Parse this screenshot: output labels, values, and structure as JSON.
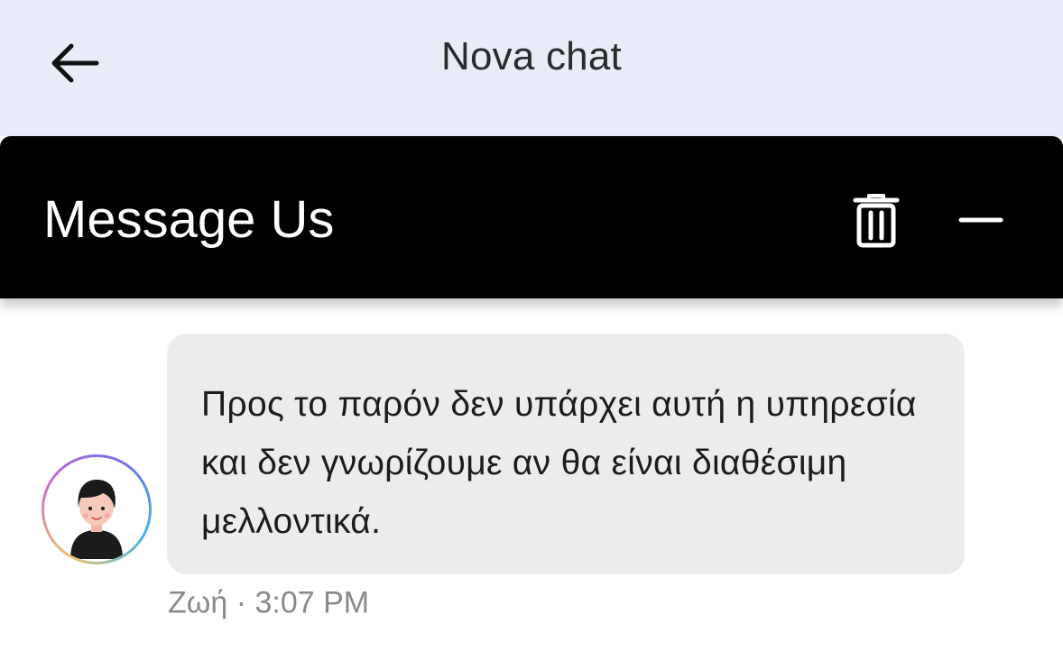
{
  "top_bar": {
    "back_icon": "arrow-left-icon",
    "title": "Nova chat"
  },
  "message_header": {
    "title": "Message Us",
    "trash_icon": "trash-icon",
    "minimize_icon": "minus-icon"
  },
  "message": {
    "text": "Προς το παρόν δεν υπάρχει αυτή η υπηρεσία και δεν γνωρίζουμε αν θα είναι διαθέσιμη μελλοντικά.",
    "sender": "Ζωή",
    "separator": "·",
    "time": "3:07 PM",
    "avatar_icon": "agent-avatar-icon"
  },
  "colors": {
    "top_bar_bg": "#e8ecf7",
    "header_bg": "#000000",
    "bubble_bg": "#ececec",
    "meta_text": "#8a8a8a"
  }
}
